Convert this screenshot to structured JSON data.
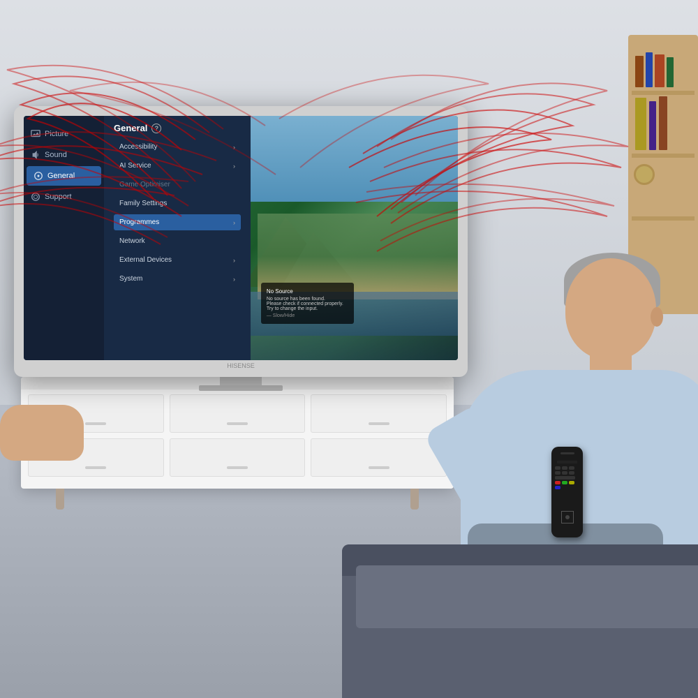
{
  "room": {
    "description": "Living room with smart TV showing settings menu"
  },
  "tv": {
    "brand": "HISENSE",
    "sidebar": {
      "items": [
        {
          "id": "picture",
          "label": "Picture",
          "icon": "picture-icon",
          "active": false
        },
        {
          "id": "sound",
          "label": "Sound",
          "icon": "sound-icon",
          "active": false
        },
        {
          "id": "general",
          "label": "General",
          "icon": "general-icon",
          "active": true
        },
        {
          "id": "support",
          "label": "Support",
          "icon": "support-icon",
          "active": false
        }
      ]
    },
    "main_panel": {
      "title": "General",
      "help_icon": "?",
      "options": [
        {
          "label": "Accessibility",
          "arrow": true,
          "dimmed": false,
          "highlighted": false
        },
        {
          "label": "AI Service",
          "arrow": true,
          "dimmed": false,
          "highlighted": false
        },
        {
          "label": "Game Optimiser",
          "arrow": false,
          "dimmed": true,
          "highlighted": false
        },
        {
          "label": "Family Settings",
          "arrow": false,
          "dimmed": false,
          "highlighted": false
        },
        {
          "label": "Programmes",
          "arrow": true,
          "dimmed": false,
          "highlighted": true
        },
        {
          "label": "Network",
          "arrow": false,
          "dimmed": false,
          "highlighted": false
        },
        {
          "label": "External Devices",
          "arrow": true,
          "dimmed": false,
          "highlighted": false
        },
        {
          "label": "System",
          "arrow": true,
          "dimmed": false,
          "highlighted": false
        }
      ]
    },
    "no_source_overlay": {
      "line1": "No Source",
      "line2": "No source has been found.",
      "line3": "Please check if connected properly.",
      "line4": "Try to change the input.",
      "line5": "— Slow/Hide"
    }
  },
  "waves": {
    "color": "#cc0000",
    "description": "Red signal waves emanating from TV screen"
  },
  "colors": {
    "tv_sidebar_bg": "#141e32",
    "tv_main_bg": "#192841",
    "active_item_bg": "#2a5fa0",
    "highlighted_option_bg": "#2a5fa0",
    "text_primary": "#ffffff",
    "text_secondary": "#aab8cc",
    "text_dimmed": "#667788",
    "wave_color": "#cc0000"
  }
}
